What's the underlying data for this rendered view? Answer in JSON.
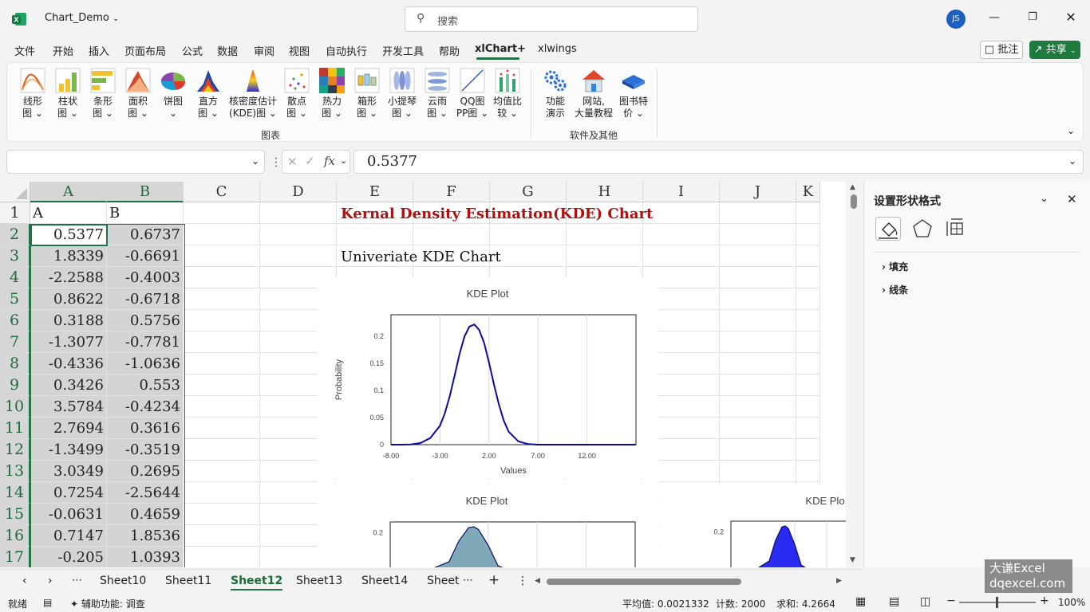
{
  "titlebar": {
    "file_name": "Chart_Demo",
    "search_placeholder": "搜索",
    "user_initials": "JS"
  },
  "menu": {
    "items": [
      "文件",
      "开始",
      "插入",
      "页面布局",
      "公式",
      "数据",
      "审阅",
      "视图",
      "自动执行",
      "开发工具",
      "帮助",
      "xlChart+",
      "xlwings"
    ],
    "active": "xlChart+",
    "comment_label": "批注",
    "share_label": "共享"
  },
  "ribbon": {
    "charts_group": "图表",
    "other_group": "软件及其他",
    "buttons": [
      {
        "label": "线形\n图 ⌄",
        "icon": "line-chart-icon"
      },
      {
        "label": "柱状\n图 ⌄",
        "icon": "column-chart-icon"
      },
      {
        "label": "条形\n图 ⌄",
        "icon": "bar-chart-icon"
      },
      {
        "label": "面积\n图 ⌄",
        "icon": "area-chart-icon"
      },
      {
        "label": "饼图\n⌄",
        "icon": "pie-chart-icon"
      },
      {
        "label": "直方\n图 ⌄",
        "icon": "histogram-icon"
      },
      {
        "label": "核密度估计\n(KDE)图 ⌄",
        "icon": "kde-chart-icon"
      },
      {
        "label": "散点\n图 ⌄",
        "icon": "scatter-chart-icon"
      },
      {
        "label": "热力\n图 ⌄",
        "icon": "heatmap-icon"
      },
      {
        "label": "箱形\n图 ⌄",
        "icon": "boxplot-icon"
      },
      {
        "label": "小提琴\n图 ⌄",
        "icon": "violin-chart-icon"
      },
      {
        "label": "云雨\n图 ⌄",
        "icon": "raincloud-chart-icon"
      },
      {
        "label": "QQ图\nPP图 ⌄",
        "icon": "qq-plot-icon"
      },
      {
        "label": "均值比\n较 ⌄",
        "icon": "mean-compare-icon"
      }
    ],
    "other_buttons": [
      {
        "label": "功能\n演示",
        "icon": "gears-icon"
      },
      {
        "label": "网站,\n大量教程",
        "icon": "house-icon"
      },
      {
        "label": "图书特\n价 ⌄",
        "icon": "books-icon"
      }
    ]
  },
  "formula": {
    "name_box": "",
    "fx": "fx",
    "value": "0.5377"
  },
  "grid": {
    "columns": [
      "A",
      "B",
      "C",
      "D",
      "E",
      "F",
      "G",
      "H",
      "I",
      "J",
      "K"
    ],
    "rows": [
      "1",
      "2",
      "3",
      "4",
      "5",
      "6",
      "7",
      "8",
      "9",
      "10",
      "11",
      "12",
      "13",
      "14",
      "15",
      "16",
      "17"
    ],
    "header_row": [
      "A",
      "B"
    ],
    "col_a": [
      "0.5377",
      "1.8339",
      "-2.2588",
      "0.8622",
      "0.3188",
      "-1.3077",
      "-0.4336",
      "0.3426",
      "3.5784",
      "2.7694",
      "-1.3499",
      "3.0349",
      "0.7254",
      "-0.0631",
      "0.7147",
      "-0.205"
    ],
    "col_b": [
      "0.6737",
      "-0.6691",
      "-0.4003",
      "-0.6718",
      "0.5756",
      "-0.7781",
      "-1.0636",
      "0.553",
      "-0.4234",
      "0.3616",
      "-0.3519",
      "0.2695",
      "-2.5644",
      "0.4659",
      "1.8536",
      "1.0393"
    ],
    "title_text": "Kernal Density Estimation(KDE) Chart",
    "subtitle_text": "Univeriate KDE Chart"
  },
  "chart_data": [
    {
      "type": "line",
      "title": "KDE Plot",
      "xlabel": "Values",
      "ylabel": "Probability",
      "x_ticks": [
        "-8.00",
        "-3.00",
        "2.00",
        "7.00",
        "12.00"
      ],
      "y_ticks": [
        "0",
        "0.05",
        "0.1",
        "0.15",
        "0.2"
      ],
      "xlim": [
        -8,
        17
      ],
      "ylim": [
        0,
        0.24
      ],
      "series": [
        {
          "color": "#0a0aa0",
          "x": [
            -8,
            -7,
            -6,
            -5,
            -4,
            -3,
            -2.5,
            -2,
            -1.5,
            -1,
            -0.5,
            0,
            0.5,
            1,
            1.5,
            2,
            2.5,
            3,
            3.5,
            4,
            5,
            6,
            7,
            8,
            10,
            12,
            14,
            17
          ],
          "y": [
            0,
            0,
            0.0005,
            0.003,
            0.012,
            0.035,
            0.058,
            0.09,
            0.128,
            0.168,
            0.2,
            0.218,
            0.222,
            0.212,
            0.188,
            0.152,
            0.112,
            0.075,
            0.045,
            0.024,
            0.006,
            0.001,
            0,
            0,
            0,
            0,
            0,
            0
          ]
        }
      ]
    },
    {
      "type": "area",
      "title": "KDE Plot",
      "y_ticks": [
        "0.2"
      ],
      "ylim": [
        0,
        0.24
      ],
      "series": [
        {
          "color": "#7fa8b8",
          "x": [
            -8,
            -2,
            -1,
            0,
            0.5,
            1,
            2,
            3,
            8,
            17
          ],
          "y": [
            0,
            0.09,
            0.168,
            0.218,
            0.222,
            0.212,
            0.152,
            0.075,
            0,
            0
          ]
        }
      ]
    },
    {
      "type": "area",
      "title": "KDE Plo",
      "y_ticks": [
        "0.2"
      ],
      "ylim": [
        0,
        0.24
      ],
      "series": [
        {
          "color": "#2a2af0",
          "x": [
            -8,
            -2,
            -1,
            0,
            0.5,
            1,
            2,
            3,
            8,
            17
          ],
          "y": [
            0,
            0.09,
            0.168,
            0.218,
            0.222,
            0.212,
            0.152,
            0.075,
            0,
            0
          ]
        }
      ]
    }
  ],
  "side_panel": {
    "title": "设置形状格式",
    "section_fill": "填充",
    "section_line": "线条"
  },
  "sheets": {
    "tabs": [
      "Sheet10",
      "Sheet11",
      "Sheet12",
      "Sheet13",
      "Sheet14",
      "Sheet"
    ],
    "active": "Sheet12"
  },
  "status": {
    "ready": "就绪",
    "accessibility": "辅助功能: 调查",
    "average": "平均值: 0.0021332",
    "count": "计数: 2000",
    "sum": "求和: 4.2664",
    "zoom": "100%"
  },
  "watermark": {
    "line1": "大谦Excel",
    "line2": "dqexcel.com"
  },
  "colors": {
    "excel_green": "#217346",
    "share_green": "#1e7b3e",
    "title_red": "#b01010",
    "avatar_blue": "#1f5fbf"
  }
}
